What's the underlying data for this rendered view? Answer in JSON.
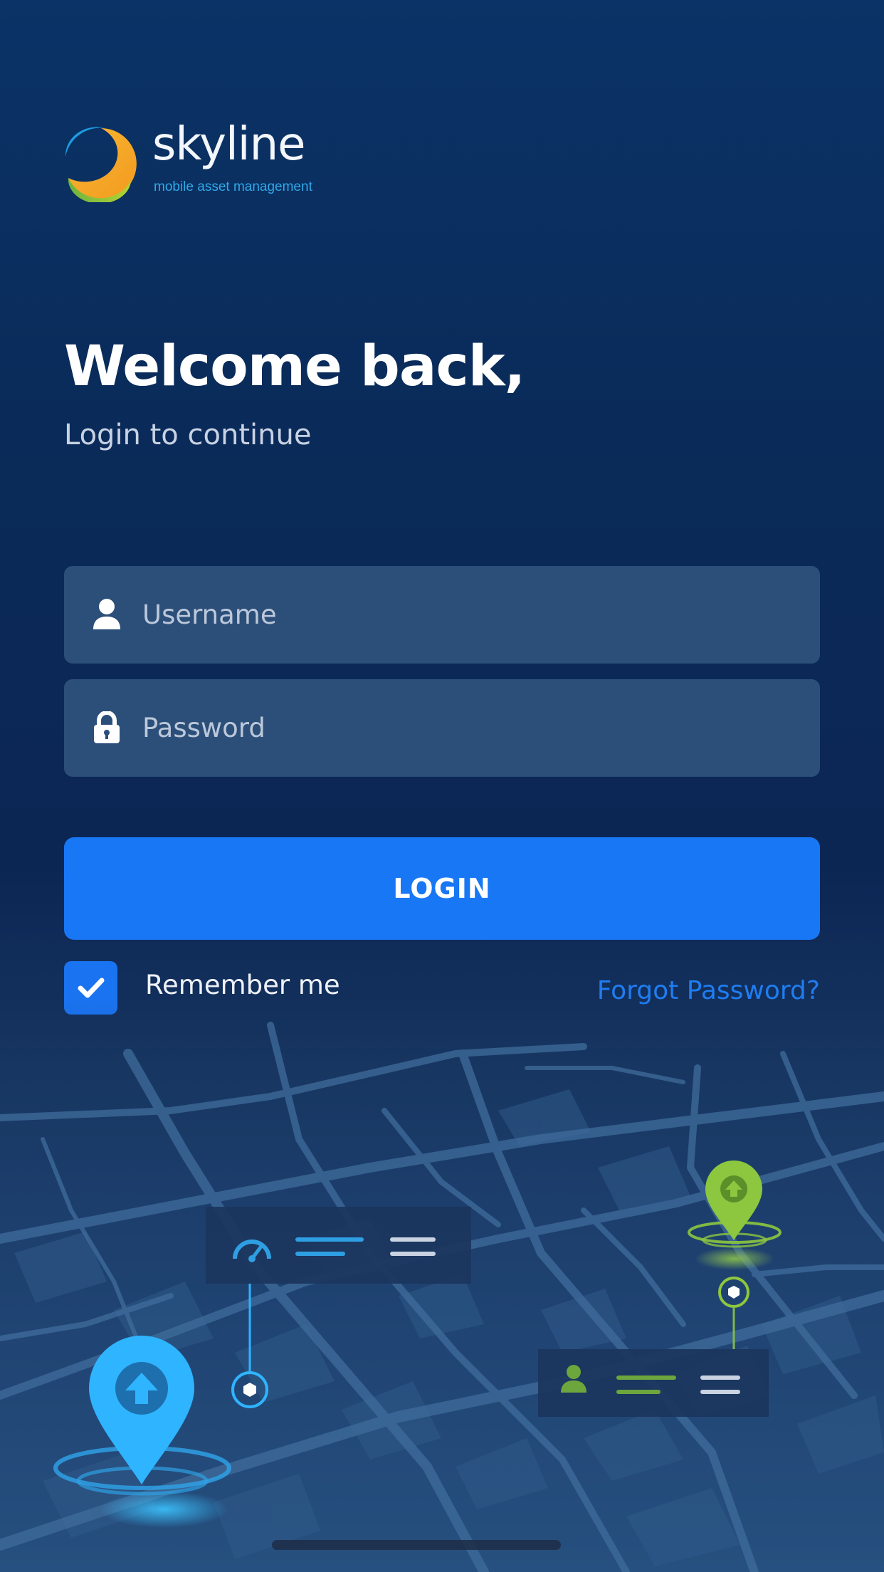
{
  "logo": {
    "name": "skyline",
    "tagline": "mobile asset management"
  },
  "heading": {
    "title": "Welcome back,",
    "subtitle": "Login to continue"
  },
  "form": {
    "username_placeholder": "Username",
    "username_value": "",
    "password_placeholder": "Password",
    "password_value": "",
    "login_label": "LOGIN",
    "remember_label": "Remember me",
    "remember_checked": true,
    "forgot_label": "Forgot Password?"
  },
  "icons": {
    "username": "user-icon",
    "password": "lock-icon",
    "checkbox": "check-icon",
    "map_speed": "speedometer-icon",
    "map_person": "person-icon",
    "pin_blue": "location-pin-icon",
    "pin_green": "location-pin-icon"
  },
  "colors": {
    "background_top": "#0b3367",
    "accent": "#1877f5",
    "field": "#2c4f7a",
    "pin_blue": "#2fb4ff",
    "pin_green": "#8dc63f",
    "link": "#1f7df0"
  }
}
